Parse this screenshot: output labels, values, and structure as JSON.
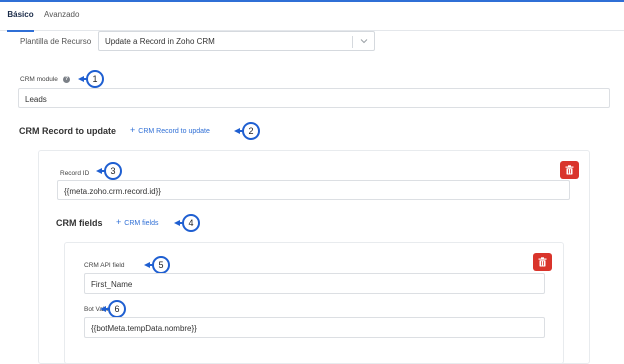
{
  "tabs": [
    {
      "label": "Básico",
      "active": true
    },
    {
      "label": "Avanzado",
      "active": false
    }
  ],
  "template": {
    "label": "Plantilla de Recurso",
    "value": "Update a Record in Zoho CRM"
  },
  "crm_module": {
    "label": "CRM module",
    "help": "?",
    "value": "Leads"
  },
  "record_section": {
    "title": "CRM Record to update",
    "add_label": "CRM Record to update",
    "plus": "+"
  },
  "record": {
    "id_label": "Record ID",
    "id_value": "{{meta.zoho.crm.record.id}}"
  },
  "fields_section": {
    "title": "CRM fields",
    "add_label": "CRM fields",
    "plus": "+"
  },
  "field": {
    "api_label": "CRM API field",
    "api_value": "First_Name",
    "bot_label": "Bot Value",
    "bot_value": "{{botMeta.tempData.nombre}}"
  },
  "callouts": [
    "1",
    "2",
    "3",
    "4",
    "5",
    "6"
  ],
  "colors": {
    "accent": "#2f6fd6",
    "callout": "#1f5fd1",
    "danger": "#d9342b"
  }
}
